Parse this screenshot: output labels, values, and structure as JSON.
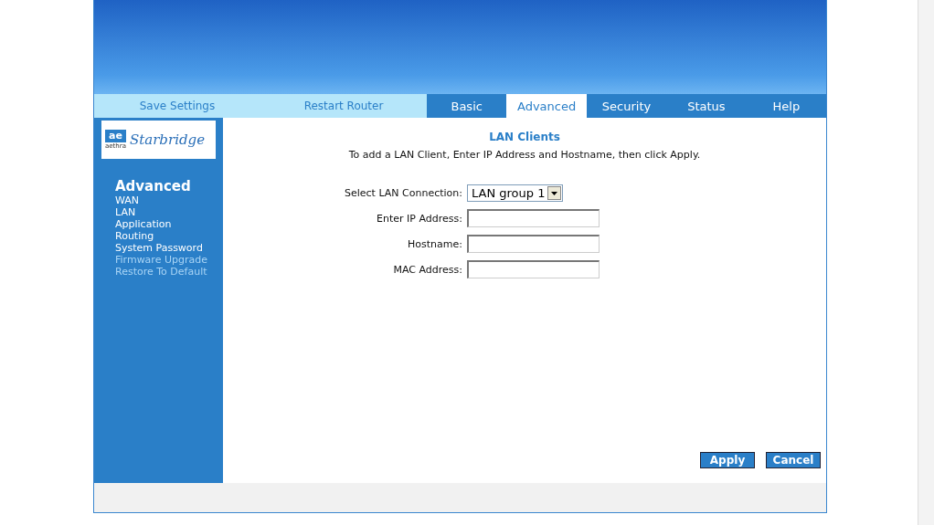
{
  "top_links": [
    {
      "label": "Save Settings"
    },
    {
      "label": "Restart Router"
    }
  ],
  "tabs": [
    {
      "label": "Basic",
      "selected": false
    },
    {
      "label": "Advanced",
      "selected": true
    },
    {
      "label": "Security",
      "selected": false
    },
    {
      "label": "Status",
      "selected": false
    },
    {
      "label": "Help",
      "selected": false
    }
  ],
  "logo": {
    "mark": "ae",
    "brand": "aethra",
    "name": "Starbridge"
  },
  "sidebar": {
    "heading": "Advanced",
    "items": [
      {
        "label": "WAN",
        "visited": false
      },
      {
        "label": "LAN",
        "visited": false
      },
      {
        "label": "Application",
        "visited": false
      },
      {
        "label": "Routing",
        "visited": false
      },
      {
        "label": "System Password",
        "visited": false
      },
      {
        "label": "Firmware Upgrade",
        "visited": true
      },
      {
        "label": "Restore To Default",
        "visited": true
      }
    ]
  },
  "content": {
    "title": "LAN Clients",
    "instruction": "To add a LAN Client, Enter IP Address and Hostname, then click Apply.",
    "fields": [
      {
        "kind": "select",
        "label": "Select LAN Connection:",
        "value": "LAN group 1"
      },
      {
        "kind": "text",
        "label": "Enter IP Address:"
      },
      {
        "kind": "text",
        "label": "Hostname:"
      },
      {
        "kind": "text",
        "label": "MAC Address:"
      }
    ],
    "buttons": [
      "Apply",
      "Cancel"
    ]
  }
}
